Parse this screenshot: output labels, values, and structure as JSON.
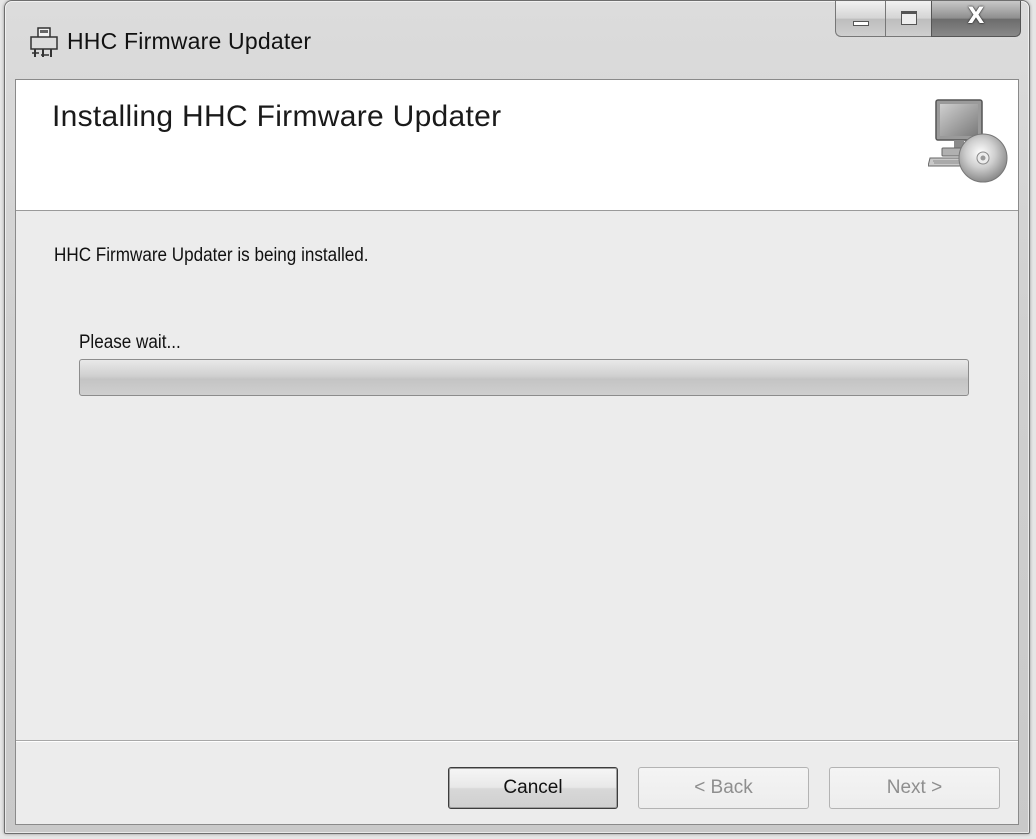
{
  "window": {
    "title": "HHC Firmware Updater"
  },
  "banner": {
    "title": "Installing HHC Firmware Updater",
    "graphic_icon": "computer-cd-icon"
  },
  "body": {
    "status_text": "HHC Firmware Updater is being installed.",
    "wait_text": "Please wait...",
    "progress_fraction": 0.0
  },
  "buttons": {
    "cancel_label": "Cancel",
    "back_label": "< Back",
    "next_label": "Next >"
  },
  "caption_buttons": {
    "minimize_icon": "minimize-icon",
    "maximize_icon": "maximize-icon",
    "close_icon": "close-icon",
    "close_glyph": "X"
  }
}
